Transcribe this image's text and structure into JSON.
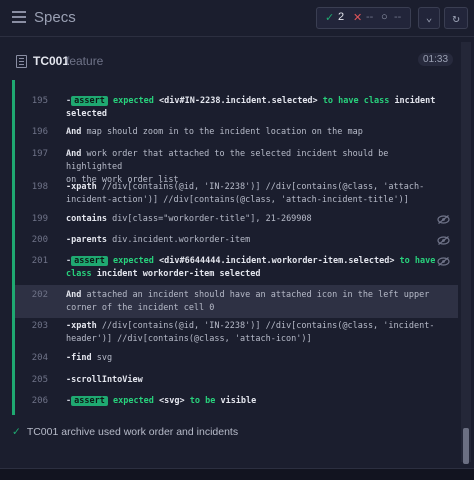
{
  "header": {
    "title": "Specs",
    "passed_icon": "✓",
    "passed": "2",
    "failed_icon": "✕",
    "failed": "--",
    "pending_icon": "○",
    "pending": "--",
    "chevron_icon": "chevron-down-icon",
    "reload_icon": "reload-icon"
  },
  "spec": {
    "name": "TC001",
    "type": "feature",
    "duration": "01:33"
  },
  "colors": {
    "accent": "#1fa971",
    "background": "#1b1e2e"
  },
  "rows": [
    {
      "num": "195",
      "dash": "-",
      "badge": "assert",
      "a": "expected ",
      "b": "<div#IN-2238.incident.selected>",
      "c": " to have class ",
      "d": "incident",
      "line2": "selected"
    },
    {
      "num": "196",
      "kw": "And",
      "text": "  map should zoom in to the incident location on the map"
    },
    {
      "num": "197",
      "kw": "And",
      "text": "  work order that attached to the selected incident should be highlighted",
      "line2": "on the work order list"
    },
    {
      "num": "198",
      "kw": "-xpath",
      "text": " //div[contains(@id, 'IN-2238')] //div[contains(@class, 'attach-",
      "line2": "incident-action')] //div[contains(@class, 'attach-incident-title')]"
    },
    {
      "num": "199",
      "kw": "contains",
      "text": " div[class=\"workorder-title\"], 21-269908"
    },
    {
      "num": "200",
      "kw": "-parents",
      "text": " div.incident.workorder-item"
    },
    {
      "num": "201",
      "dash": "-",
      "badge": "assert",
      "a": "expected ",
      "b": "<div#6644444.incident.workorder-item.selected>",
      "c": " to have",
      "line2a": "class ",
      "line2b": "incident workorder-item selected"
    },
    {
      "num": "202",
      "kw": "And",
      "text": "  attached an incident should have an attached icon in the left upper",
      "line2": "corner of the incident cell 0"
    },
    {
      "num": "203",
      "kw": "-xpath",
      "text": " //div[contains(@id, 'IN-2238')] //div[contains(@class, 'incident-",
      "line2": "header')] //div[contains(@class, 'attach-icon')]"
    },
    {
      "num": "204",
      "kw": "-find",
      "text": " svg"
    },
    {
      "num": "205",
      "kw": "-scrollIntoView",
      "text": ""
    },
    {
      "num": "206",
      "dash": "-",
      "badge": "assert",
      "a": "expected ",
      "b": "<svg>",
      "c": " to be ",
      "d": "visible"
    }
  ],
  "footer": {
    "check": "✓",
    "text": "TC001 archive used work order and incidents"
  }
}
